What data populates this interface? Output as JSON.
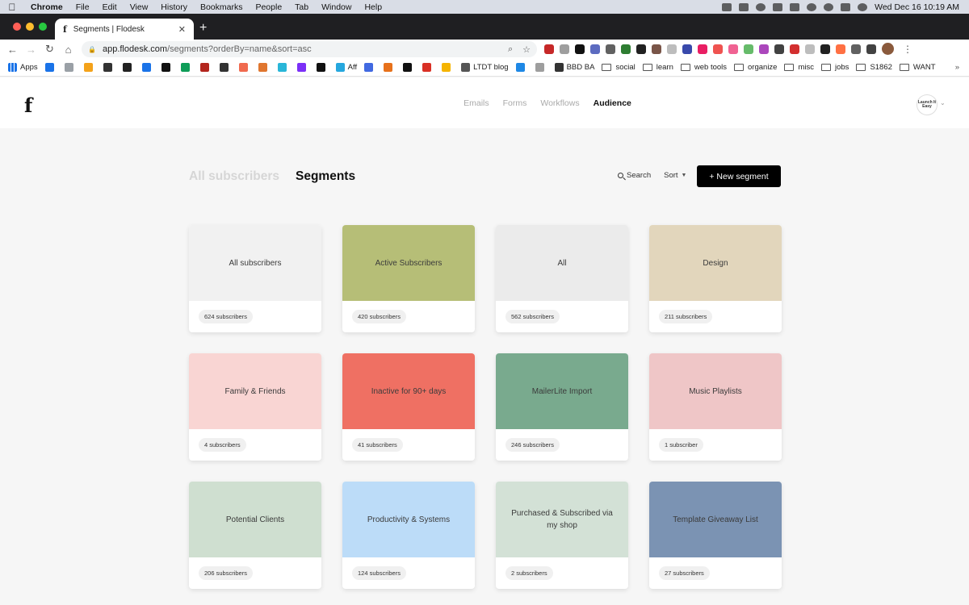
{
  "menubar": {
    "app": "Chrome",
    "items": [
      "File",
      "Edit",
      "View",
      "History",
      "Bookmarks",
      "People",
      "Tab",
      "Window",
      "Help"
    ],
    "clock": "Wed Dec 16  10:19 AM"
  },
  "browser": {
    "tab_title": "Segments | Flodesk",
    "tab_favicon": "f",
    "url_domain": "app.flodesk.com",
    "url_path": "/segments?orderBy=name&sort=asc",
    "bookmarks": [
      {
        "label": "Apps",
        "type": "apps"
      },
      {
        "label": "",
        "type": "icon",
        "color": "#1a73e8"
      },
      {
        "label": "",
        "type": "icon",
        "color": "#9aa0a6"
      },
      {
        "label": "",
        "type": "icon",
        "color": "#f4a21a"
      },
      {
        "label": "",
        "type": "icon",
        "color": "#333333"
      },
      {
        "label": "",
        "type": "icon",
        "color": "#222222"
      },
      {
        "label": "",
        "type": "icon",
        "color": "#1a73e8"
      },
      {
        "label": "",
        "type": "icon",
        "color": "#111111"
      },
      {
        "label": "",
        "type": "icon",
        "color": "#0f9d58"
      },
      {
        "label": "",
        "type": "icon",
        "color": "#b3261e"
      },
      {
        "label": "",
        "type": "icon",
        "color": "#333333"
      },
      {
        "label": "",
        "type": "icon",
        "color": "#f06a4f"
      },
      {
        "label": "",
        "type": "icon",
        "color": "#e0762f"
      },
      {
        "label": "",
        "type": "icon",
        "color": "#29b6d8"
      },
      {
        "label": "",
        "type": "icon",
        "color": "#7b2ff7"
      },
      {
        "label": "",
        "type": "icon",
        "color": "#111111"
      },
      {
        "label": "Aff",
        "type": "icon",
        "color": "#26a7de"
      },
      {
        "label": "",
        "type": "icon",
        "color": "#4169e1"
      },
      {
        "label": "",
        "type": "icon",
        "color": "#e7711b"
      },
      {
        "label": "",
        "type": "icon",
        "color": "#111111"
      },
      {
        "label": "",
        "type": "icon",
        "color": "#d93025"
      },
      {
        "label": "",
        "type": "icon",
        "color": "#f5b400"
      },
      {
        "label": "LTDT blog",
        "type": "icon",
        "color": "#555555"
      },
      {
        "label": "",
        "type": "icon",
        "color": "#1e88e5"
      },
      {
        "label": "",
        "type": "icon",
        "color": "#9e9e9e"
      },
      {
        "label": "BBD BA",
        "type": "icon",
        "color": "#333333"
      },
      {
        "label": "social",
        "type": "folder"
      },
      {
        "label": "learn",
        "type": "folder"
      },
      {
        "label": "web tools",
        "type": "folder"
      },
      {
        "label": "organize",
        "type": "folder"
      },
      {
        "label": "misc",
        "type": "folder"
      },
      {
        "label": "jobs",
        "type": "folder"
      },
      {
        "label": "S1862",
        "type": "folder"
      },
      {
        "label": "WANT",
        "type": "folder"
      }
    ],
    "bookmarks_more": "»"
  },
  "header": {
    "logo": "f",
    "nav": [
      {
        "label": "Emails",
        "active": false
      },
      {
        "label": "Forms",
        "active": false
      },
      {
        "label": "Workflows",
        "active": false
      },
      {
        "label": "Audience",
        "active": true
      }
    ],
    "account_label": "Launch It Easy"
  },
  "page": {
    "tabs": [
      {
        "label": "All subscribers",
        "active": false
      },
      {
        "label": "Segments",
        "active": true
      }
    ],
    "search_label": "Search",
    "sort_label": "Sort",
    "new_button": "+ New segment"
  },
  "segments": [
    {
      "name": "All subscribers",
      "count": "624 subscribers",
      "color": "#f1f1f1"
    },
    {
      "name": "Active Subscribers",
      "count": "420 subscribers",
      "color": "#b6be77"
    },
    {
      "name": "All",
      "count": "562 subscribers",
      "color": "#ebebeb"
    },
    {
      "name": "Design",
      "count": "211 subscribers",
      "color": "#e2d6bc"
    },
    {
      "name": "Family & Friends",
      "count": "4 subscribers",
      "color": "#f9d5d3"
    },
    {
      "name": "Inactive for 90+ days",
      "count": "41 subscribers",
      "color": "#ef7063"
    },
    {
      "name": "MailerLite Import",
      "count": "246 subscribers",
      "color": "#79aa8e"
    },
    {
      "name": "Music Playlists",
      "count": "1 subscriber",
      "color": "#efc6c7"
    },
    {
      "name": "Potential Clients",
      "count": "206 subscribers",
      "color": "#cfdfd0"
    },
    {
      "name": "Productivity & Systems",
      "count": "124 subscribers",
      "color": "#bcdcf8"
    },
    {
      "name": "Purchased & Subscribed via my shop",
      "count": "2 subscribers",
      "color": "#d3e1d6"
    },
    {
      "name": "Template Giveaway List",
      "count": "27 subscribers",
      "color": "#7b93b3"
    }
  ]
}
